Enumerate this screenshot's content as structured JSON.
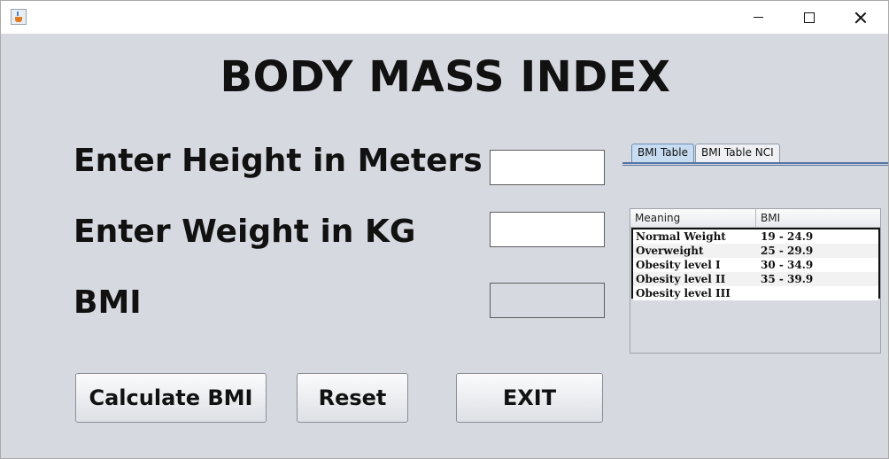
{
  "titlebar": {
    "app_icon": "java-coffee-cup-icon",
    "minimize_icon": "minimize-icon",
    "maximize_icon": "maximize-icon",
    "close_icon": "close-icon"
  },
  "main": {
    "title": "BODY MASS INDEX",
    "height_label": "Enter Height in Meters",
    "weight_label": "Enter Weight in KG",
    "bmi_label": "BMI",
    "height_value": "",
    "weight_value": "",
    "bmi_value": ""
  },
  "buttons": {
    "calculate": "Calculate BMI",
    "reset": "Reset",
    "exit": "EXIT"
  },
  "tabs": [
    {
      "label": "BMI Table",
      "active": true
    },
    {
      "label": "BMI Table NCI",
      "active": false
    }
  ],
  "bmi_table": {
    "headers": [
      "Meaning",
      "BMI"
    ],
    "rows": [
      {
        "meaning": "Normal Weight",
        "bmi": "19 - 24.9"
      },
      {
        "meaning": "Overweight",
        "bmi": "25 - 29.9"
      },
      {
        "meaning": "Obesity level I",
        "bmi": "30 - 34.9"
      },
      {
        "meaning": "Obesity level II",
        "bmi": "35 - 39.9"
      },
      {
        "meaning": "Obesity level III",
        "bmi": ""
      }
    ]
  },
  "colors": {
    "window_bg": "#d6d9df",
    "active_tab": "#c7dbf1",
    "tab_border": "#5474a3"
  }
}
